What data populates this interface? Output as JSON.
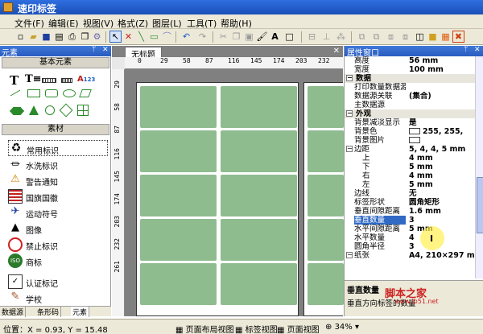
{
  "app": {
    "title": "速印标签"
  },
  "menu": [
    "文件(F)",
    "编辑(E)",
    "视图(V)",
    "格式(Z)",
    "图层(L)",
    "工具(T)",
    "帮助(H)"
  ],
  "left_panel": {
    "header": "元素",
    "section_basic": "基本元素",
    "section_material": "素材",
    "items": [
      "常用标识",
      "水洗标识",
      "警告通知",
      "国旗国徽",
      "运动符号",
      "图像",
      "禁止标识",
      "商标",
      "认证标记",
      "学校"
    ],
    "tabs": [
      "数据源",
      "条形码",
      "元素"
    ]
  },
  "document": {
    "tab": "无标题",
    "ruler_h": [
      "0",
      "29",
      "58",
      "87",
      "116",
      "145",
      "174",
      "203",
      "232"
    ],
    "ruler_v": [
      "29",
      "58",
      "87",
      "116",
      "145",
      "174",
      "203",
      "232",
      "261"
    ]
  },
  "props": {
    "header": "属性窗口",
    "rows": [
      {
        "k": "高度",
        "v": "56 mm"
      },
      {
        "k": "宽度",
        "v": "100 mm"
      },
      {
        "k": "数据",
        "cat": true
      },
      {
        "k": "打印数量数据源",
        "v": ""
      },
      {
        "k": "数据源关联",
        "v": "(集合)"
      },
      {
        "k": "主数据源",
        "v": ""
      },
      {
        "k": "外观",
        "cat": true
      },
      {
        "k": "背景减淡显示",
        "v": "是"
      },
      {
        "k": "背景色",
        "v": "255, 255,",
        "swatch": true
      },
      {
        "k": "背景图片",
        "v": "",
        "swatch": true
      },
      {
        "k": "边距",
        "v": "5, 4, 4, 5 mm",
        "exp": true
      },
      {
        "k": "上",
        "v": "4 mm",
        "indent": true
      },
      {
        "k": "下",
        "v": "5 mm",
        "indent": true
      },
      {
        "k": "右",
        "v": "4 mm",
        "indent": true
      },
      {
        "k": "左",
        "v": "5 mm",
        "indent": true
      },
      {
        "k": "边线",
        "v": "无"
      },
      {
        "k": "标签形状",
        "v": "圆角矩形"
      },
      {
        "k": "垂直间隙距离",
        "v": "1.6 mm"
      },
      {
        "k": "垂直数量",
        "v": "3",
        "sel": true
      },
      {
        "k": "水平间隙距离",
        "v": "5 mm"
      },
      {
        "k": "水平数量",
        "v": "4"
      },
      {
        "k": "圆角半径",
        "v": "3"
      },
      {
        "k": "纸张",
        "v": "A4, 210×297 m",
        "exp": true
      }
    ],
    "desc_title": "垂直数量",
    "desc_text": "垂直方向标签的数量"
  },
  "watermark": {
    "text": "脚本之家",
    "url": "www.jb51.net"
  },
  "status": {
    "coords": "位置：X = 0.93, Y = 15.48",
    "b1": "页面布局视图",
    "b2": "标签视图",
    "b3": "页面视图",
    "zoom": "34%"
  }
}
